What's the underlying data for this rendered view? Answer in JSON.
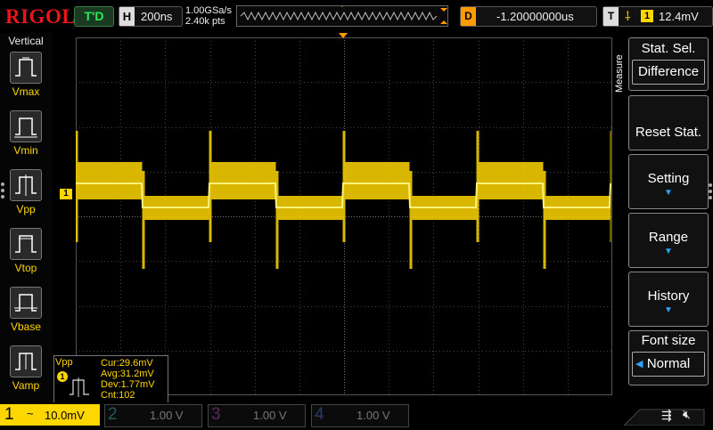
{
  "topbar": {
    "logo": "RIGOL",
    "status": "T'D",
    "horizontal_label": "H",
    "timebase": "200ns",
    "sample_rate": "1.00GSa/s",
    "memory_depth": "2.40k pts",
    "delay_label": "D",
    "delay": "-1.20000000us",
    "trigger_label": "T",
    "trigger_channel": "1",
    "trigger_level": "12.4mV"
  },
  "left_panel": {
    "title": "Vertical",
    "items": [
      {
        "label": "Vmax"
      },
      {
        "label": "Vmin"
      },
      {
        "label": "Vpp"
      },
      {
        "label": "Vtop"
      },
      {
        "label": "Vbase"
      },
      {
        "label": "Vamp"
      }
    ]
  },
  "right_menu": {
    "tab": "Measure",
    "stat_sel_title": "Stat. Sel.",
    "stat_sel_value": "Difference",
    "reset": "Reset Stat.",
    "setting": "Setting",
    "range": "Range",
    "history": "History",
    "font_title": "Font size",
    "font_value": "Normal"
  },
  "stats": {
    "name": "Vpp",
    "channel": "1",
    "cur": "Cur:29.6mV",
    "avg": "Avg:31.2mV",
    "dev": "Dev:1.77mV",
    "cnt": "Cnt:102"
  },
  "bottom": {
    "ch1_num": "1",
    "ch1_coupling": "~",
    "ch1_scale": "10.0mV",
    "ch2_num": "2",
    "ch2_scale": "1.00 V",
    "ch3_num": "3",
    "ch3_scale": "1.00 V",
    "ch4_num": "4",
    "ch4_scale": "1.00 V"
  },
  "markers": {
    "ch1_ground": "1",
    "trigger_marker": "T"
  },
  "colors": {
    "ch1": "#ffd700",
    "ch2": "#00c0c0",
    "ch3": "#e040e0",
    "ch4": "#2f6fff",
    "accent": "#ff9900"
  }
}
